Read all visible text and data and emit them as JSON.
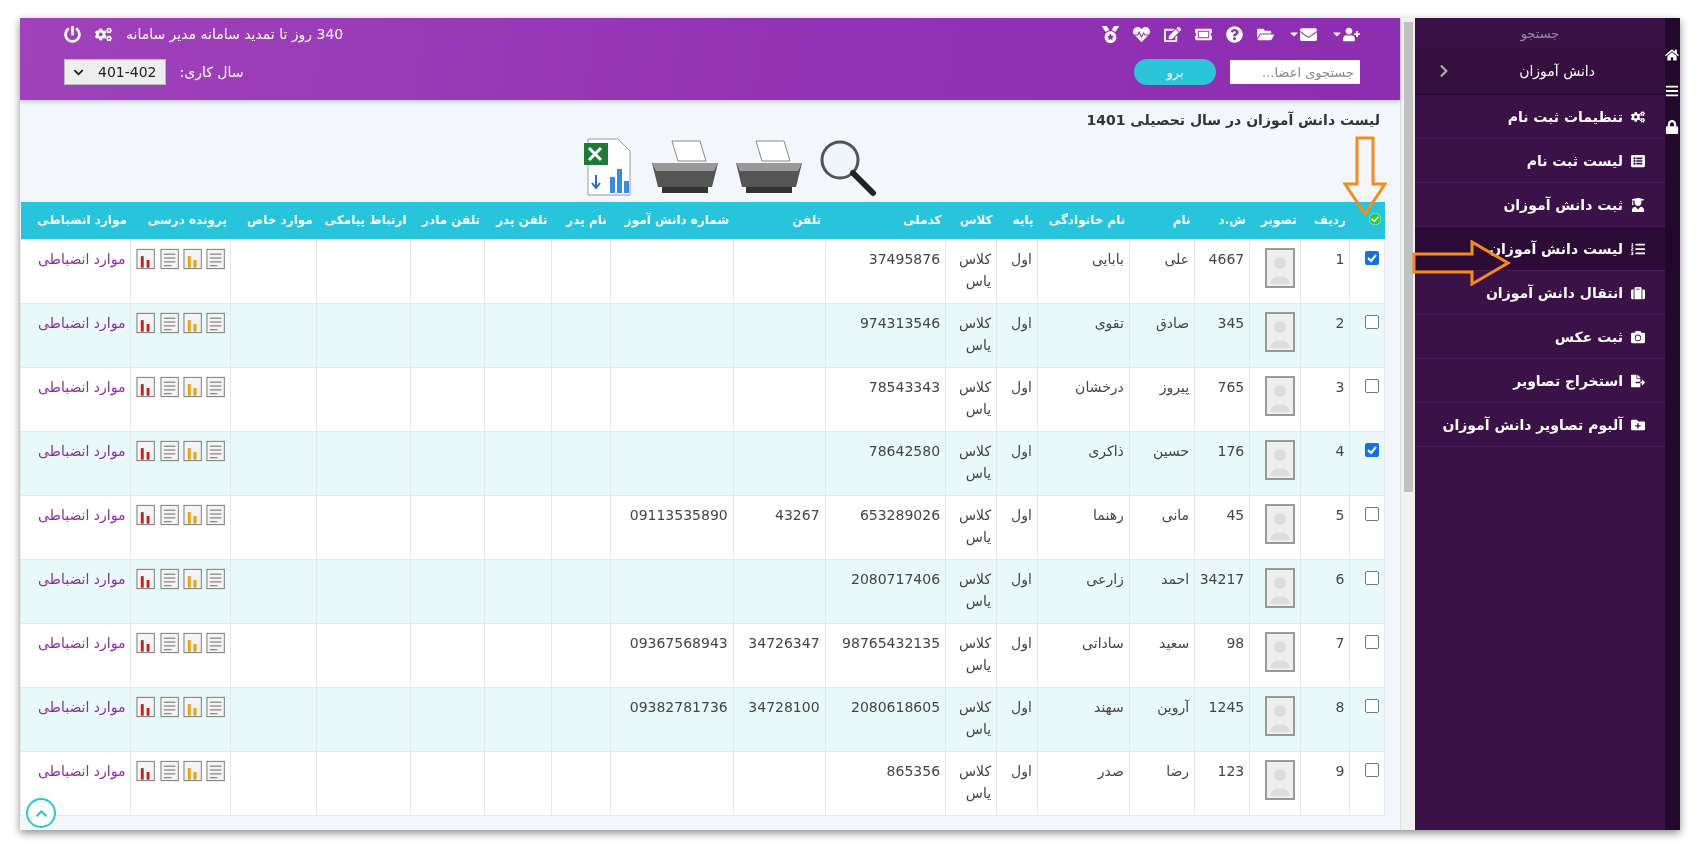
{
  "top_bar": {
    "notice": "340 روز تا تمدید سامانه مدیر سامانه",
    "year_label": "سال کاری:",
    "year_value": "401-402",
    "search_placeholder": "جستجوی اعضا...",
    "search_button": "برو"
  },
  "page_title": "لیست دانش آموزان در سال تحصیلی 1401",
  "table": {
    "columns": [
      "ردیف",
      "تصویر",
      "ش.د",
      "نام",
      "نام خانوادگی",
      "پایه",
      "کلاس",
      "کدملی",
      "تلفن",
      "شماره دانش آموز",
      "نام پدر",
      "تلفن پدر",
      "تلفن مادر",
      "ارتباط پیامکی",
      "موارد خاص",
      "پرونده درسی",
      "موارد انضباطی"
    ],
    "rows": [
      {
        "checked": true,
        "row": "1",
        "code": "4667",
        "first_name": "علی",
        "last_name": "بابایی",
        "grade": "اول",
        "class": "کلاس یاس",
        "national_id": "37495876",
        "discipline": "موارد انضباطی"
      },
      {
        "checked": false,
        "row": "2",
        "code": "345",
        "first_name": "صادق",
        "last_name": "تقوی",
        "grade": "اول",
        "class": "کلاس یاس",
        "national_id": "974313546",
        "discipline": "موارد انضباطی"
      },
      {
        "checked": false,
        "row": "3",
        "code": "765",
        "first_name": "پیروز",
        "last_name": "درخشان",
        "grade": "اول",
        "class": "کلاس یاس",
        "national_id": "78543343",
        "discipline": "موارد انضباطی"
      },
      {
        "checked": true,
        "row": "4",
        "code": "176",
        "first_name": "حسین",
        "last_name": "ذاکری",
        "grade": "اول",
        "class": "کلاس یاس",
        "national_id": "78642580",
        "discipline": "موارد انضباطی"
      },
      {
        "checked": false,
        "row": "5",
        "code": "45",
        "first_name": "مانی",
        "last_name": "رهنما",
        "grade": "اول",
        "class": "کلاس یاس",
        "national_id": "653289026",
        "phone": "43267",
        "student_number": "09113535890",
        "discipline": "موارد انضباطی"
      },
      {
        "checked": false,
        "row": "6",
        "code": "34217",
        "first_name": "احمد",
        "last_name": "زارعی",
        "grade": "اول",
        "class": "کلاس یاس",
        "national_id": "2080717406",
        "discipline": "موارد انضباطی"
      },
      {
        "checked": false,
        "row": "7",
        "code": "98",
        "first_name": "سعید",
        "last_name": "ساداتی",
        "grade": "اول",
        "class": "کلاس یاس",
        "national_id": "98765432135",
        "phone": "34726347",
        "student_number": "09367568943",
        "discipline": "موارد انضباطی"
      },
      {
        "checked": false,
        "row": "8",
        "code": "1245",
        "first_name": "آروین",
        "last_name": "سهند",
        "grade": "اول",
        "class": "کلاس یاس",
        "national_id": "2080618605",
        "phone": "34728100",
        "student_number": "09382781736",
        "discipline": "موارد انضباطی"
      },
      {
        "checked": false,
        "row": "9",
        "code": "123",
        "first_name": "رضا",
        "last_name": "صدر",
        "grade": "اول",
        "class": "کلاس یاس",
        "national_id": "865356",
        "discipline": "موارد انضباطی"
      }
    ]
  },
  "sidebar": {
    "search_label": "جستجو",
    "section": "دانش آموزان",
    "items": [
      {
        "label": "تنظیمات ثبت نام",
        "selected": false
      },
      {
        "label": "لیست ثبت نام",
        "selected": false
      },
      {
        "label": "ثبت دانش آموزان",
        "selected": false
      },
      {
        "label": "لیست دانش آموزان",
        "selected": true
      },
      {
        "label": "انتقال دانش آموزان",
        "selected": false
      },
      {
        "label": "ثبت عکس",
        "selected": false
      },
      {
        "label": "استخراج تصاویر",
        "selected": false
      },
      {
        "label": "آلبوم تصاویر دانش آموزان",
        "selected": false
      }
    ]
  }
}
